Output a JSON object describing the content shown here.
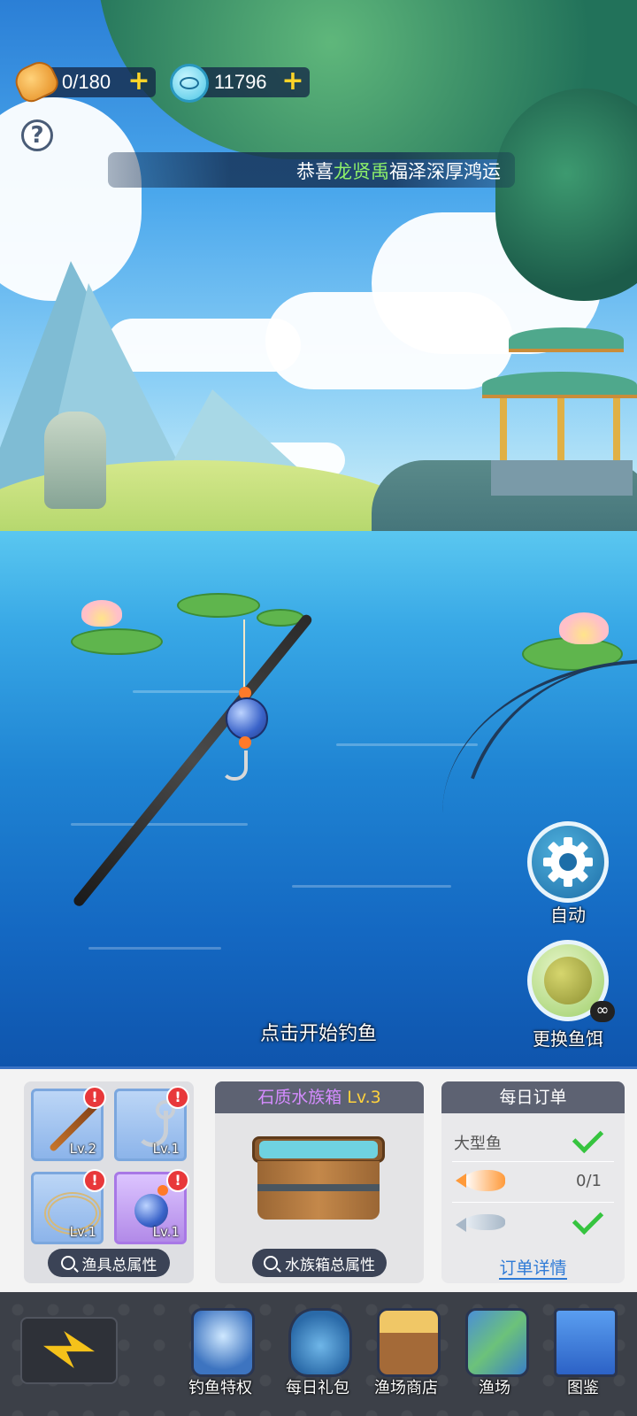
{
  "hud": {
    "bread": {
      "icon": "bread-icon",
      "value": "0/180",
      "plus": "+"
    },
    "fishcoin": {
      "icon": "fish-coin-icon",
      "value": "11796",
      "plus": "+"
    },
    "help": "?",
    "announcement": {
      "prefix": "恭喜",
      "name": "龙贤禹",
      "suffix": "福泽深厚鸿运"
    }
  },
  "scene": {
    "tap_hint": "点击开始钓鱼"
  },
  "side_buttons": {
    "auto": {
      "icon": "gear-icon",
      "label": "自动"
    },
    "bait": {
      "icon": "bait-ball-icon",
      "label": "更换鱼饵",
      "count": "∞"
    }
  },
  "gear": {
    "slots": [
      {
        "icon": "fishing-rod-icon",
        "level": "Lv.2",
        "badge": "!",
        "rarity": "blue"
      },
      {
        "icon": "hook-icon",
        "level": "Lv.1",
        "badge": "!",
        "rarity": "blue"
      },
      {
        "icon": "fishing-line-icon",
        "level": "Lv.1",
        "badge": "!",
        "rarity": "blue"
      },
      {
        "icon": "bobber-icon",
        "level": "Lv.1",
        "badge": "!",
        "rarity": "purple"
      }
    ],
    "attr_button": "渔具总属性"
  },
  "tank": {
    "name": "石质水族箱",
    "level": "Lv.3",
    "attr_button": "水族箱总属性"
  },
  "orders": {
    "title": "每日订单",
    "rows": [
      {
        "label": "大型鱼",
        "status": "done"
      },
      {
        "label": "",
        "fish": "koi-fish-icon",
        "progress": "0/1",
        "status": "pending"
      },
      {
        "label": "",
        "fish": "silver-fish-icon",
        "status": "done"
      }
    ],
    "detail_link": "订单详情"
  },
  "nav": {
    "back_icon": "lightning-icon",
    "items": [
      {
        "label": "钓鱼特权",
        "icon": "fishing-privilege-icon"
      },
      {
        "label": "每日礼包",
        "icon": "daily-gift-bag-icon"
      },
      {
        "label": "渔场商店",
        "icon": "fishery-shop-icon"
      },
      {
        "label": "渔场",
        "icon": "fishery-map-icon"
      },
      {
        "label": "图鉴",
        "icon": "fish-encyclopedia-icon"
      }
    ]
  },
  "colors": {
    "panel_accent": "#3a72c4",
    "highlight_name": "#8df06a",
    "tank_name": "#d58cff",
    "tank_level": "#ffd23d",
    "check": "#36c43f",
    "badge": "#e8383a"
  }
}
